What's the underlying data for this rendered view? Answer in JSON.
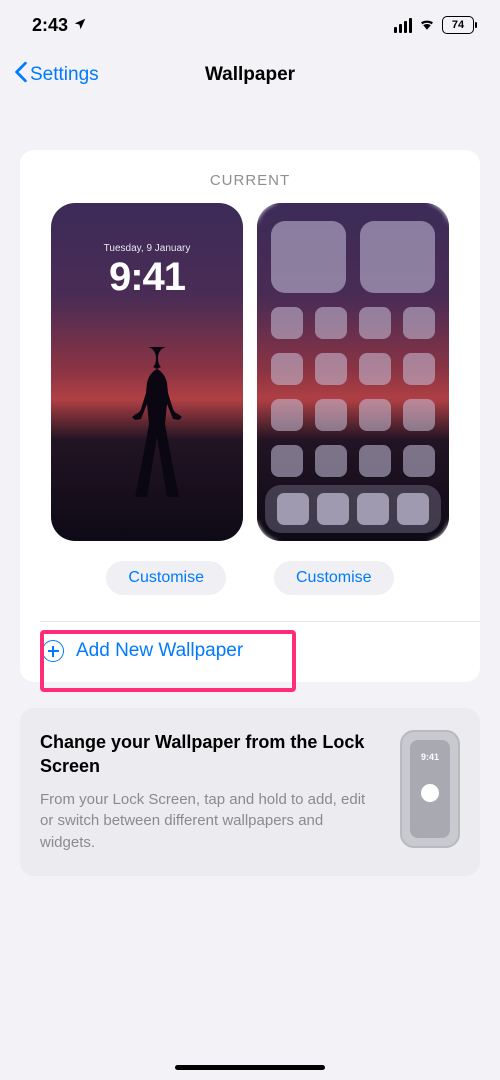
{
  "status": {
    "time": "2:43",
    "battery": "74"
  },
  "nav": {
    "back_label": "Settings",
    "title": "Wallpaper"
  },
  "current": {
    "label": "CURRENT",
    "lock_date": "Tuesday, 9 January",
    "lock_time": "9:41",
    "customise_left": "Customise",
    "customise_right": "Customise"
  },
  "add": {
    "label": "Add New Wallpaper"
  },
  "info": {
    "title": "Change your Wallpaper from the Lock Screen",
    "body": "From your Lock Screen, tap and hold to add, edit or switch between different wallpapers and widgets.",
    "mini_time": "9:41"
  }
}
